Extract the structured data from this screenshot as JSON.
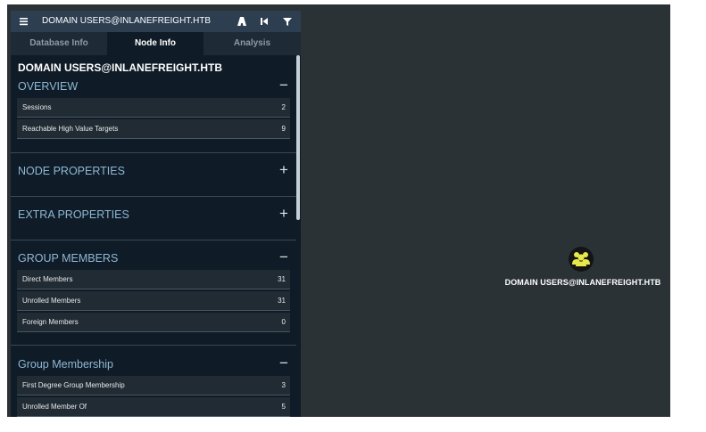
{
  "search": {
    "value": "DOMAIN USERS@INLANEFREIGHT.HTB"
  },
  "toolbar": {
    "icons": [
      "path-icon",
      "back-icon",
      "filter-icon"
    ]
  },
  "tabs": [
    {
      "label": "Database Info",
      "active": false
    },
    {
      "label": "Node Info",
      "active": true
    },
    {
      "label": "Analysis",
      "active": false
    }
  ],
  "node_info": {
    "title": "DOMAIN USERS@INLANEFREIGHT.HTB",
    "sections": {
      "overview": {
        "label": "OVERVIEW",
        "toggle": "−",
        "rows": [
          {
            "key": "Sessions",
            "value": "2"
          },
          {
            "key": "Reachable High Value Targets",
            "value": "9"
          }
        ]
      },
      "node_properties": {
        "label": "NODE PROPERTIES",
        "toggle": "+"
      },
      "extra_properties": {
        "label": "EXTRA PROPERTIES",
        "toggle": "+"
      },
      "group_members": {
        "label": "GROUP MEMBERS",
        "toggle": "−",
        "rows": [
          {
            "key": "Direct Members",
            "value": "31"
          },
          {
            "key": "Unrolled Members",
            "value": "31"
          },
          {
            "key": "Foreign Members",
            "value": "0"
          }
        ]
      },
      "group_membership": {
        "label": "Group Membership",
        "toggle": "−",
        "rows": [
          {
            "key": "First Degree Group Membership",
            "value": "3"
          },
          {
            "key": "Unrolled Member Of",
            "value": "5"
          }
        ]
      }
    }
  },
  "graph": {
    "node": {
      "label": "DOMAIN USERS@INLANEFREIGHT.HTB",
      "icon": "group-icon",
      "icon_color": "#e8e84a"
    }
  },
  "colors": {
    "panel_bg": "#0f1b26",
    "topbar_bg": "#2c3e50",
    "section_label": "#8fb8d6",
    "graph_bg": "#2b3236"
  }
}
